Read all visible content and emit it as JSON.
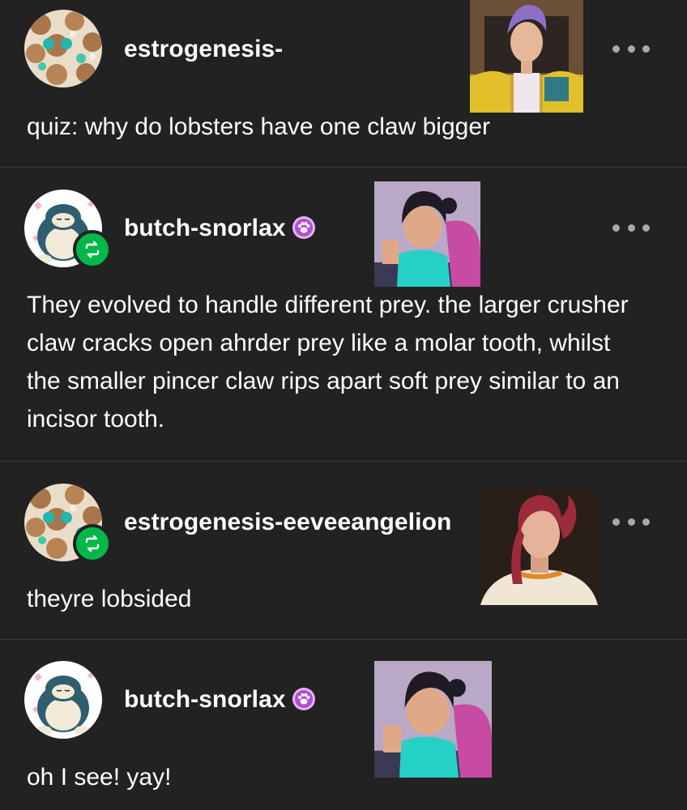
{
  "posts": [
    {
      "username": "estrogenesis-",
      "text": "quiz: why do lobsters have one claw bigger",
      "reblogged": false,
      "avatar": "eevee-pattern-avatar",
      "sticker": "purple-hair-character-sticker",
      "more_icon": "more-horizontal-icon"
    },
    {
      "username": "butch-snorlax",
      "badge": "paw-badge",
      "text": "They evolved to handle different prey. the larger crusher claw cracks open ahrder prey like a molar tooth, whilst the smaller pincer claw rips apart soft prey similar to an incisor tooth.",
      "reblogged": true,
      "avatar": "snorlax-avatar",
      "sticker": "dark-hair-character-sticker",
      "more_icon": "more-horizontal-icon"
    },
    {
      "username": "estrogenesis-eeveeangelion",
      "text": "theyre lobsided",
      "reblogged": true,
      "avatar": "eevee-pattern-avatar",
      "sticker": "red-hair-character-sticker",
      "more_icon": "more-horizontal-icon"
    },
    {
      "username": "butch-snorlax",
      "badge": "paw-badge",
      "text": "oh I see! yay!",
      "reblogged": false,
      "avatar": "snorlax-avatar",
      "sticker": "dark-hair-character-sticker",
      "more_icon": "more-horizontal-icon"
    }
  ],
  "colors": {
    "background": "#222223",
    "divider": "#3a3a3b",
    "reblog_green": "#00b84a",
    "paw_badge": "#e8b3f2",
    "dots": "#a9a9ab"
  }
}
